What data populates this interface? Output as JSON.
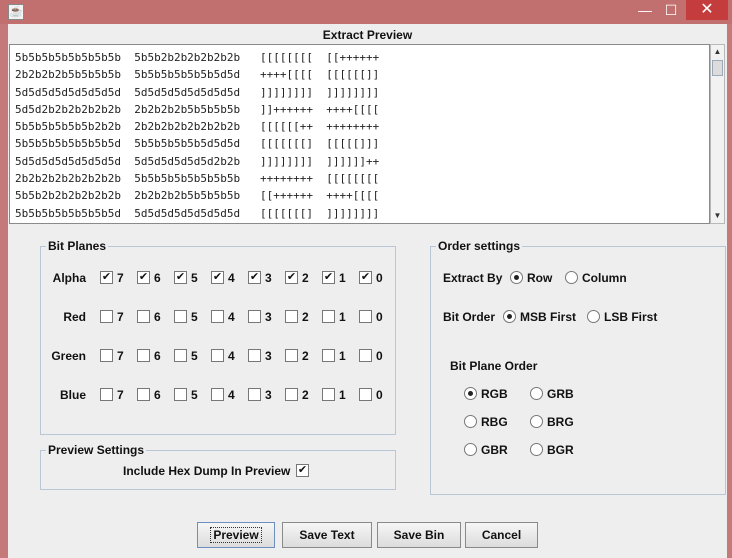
{
  "window": {
    "app_icon": "java-icon",
    "min_glyph": "—",
    "max_glyph": "☐",
    "close_glyph": "✕"
  },
  "preview": {
    "title": "Extract Preview",
    "lines": [
      "5b5b5b5b5b5b5b5b  5b5b2b2b2b2b2b2b   [[[[[[[[  [[++++++",
      "2b2b2b2b5b5b5b5b  5b5b5b5b5b5b5d5d   ++++[[[[  [[[[[[]]",
      "5d5d5d5d5d5d5d5d  5d5d5d5d5d5d5d5d   ]]]]]]]]  ]]]]]]]]",
      "5d5d2b2b2b2b2b2b  2b2b2b2b5b5b5b5b   ]]++++++  ++++[[[[",
      "5b5b5b5b5b5b2b2b  2b2b2b2b2b2b2b2b   [[[[[[++  ++++++++",
      "5b5b5b5b5b5b5b5d  5b5b5b5b5b5d5d5d   [[[[[[[]  [[[[[]]]",
      "5d5d5d5d5d5d5d5d  5d5d5d5d5d5d2b2b   ]]]]]]]]  ]]]]]]++",
      "2b2b2b2b2b2b2b2b  5b5b5b5b5b5b5b5b   ++++++++  [[[[[[[[",
      "5b5b2b2b2b2b2b2b  2b2b2b2b5b5b5b5b   [[++++++  ++++[[[[",
      "5b5b5b5b5b5b5b5d  5d5d5d5d5d5d5d5d   [[[[[[[]  ]]]]]]]]",
      "5d5d5d5d5d5d5d5d  5d5d5d2b2b2b2b2b   ]]]]]]]]  ]]]]]]]]"
    ]
  },
  "bit_planes": {
    "title": "Bit Planes",
    "bits": [
      "7",
      "6",
      "5",
      "4",
      "3",
      "2",
      "1",
      "0"
    ],
    "rows": [
      {
        "label": "Alpha",
        "checked": [
          true,
          true,
          true,
          true,
          true,
          true,
          true,
          true
        ]
      },
      {
        "label": "Red",
        "checked": [
          false,
          false,
          false,
          false,
          false,
          false,
          false,
          false
        ]
      },
      {
        "label": "Green",
        "checked": [
          false,
          false,
          false,
          false,
          false,
          false,
          false,
          false
        ]
      },
      {
        "label": "Blue",
        "checked": [
          false,
          false,
          false,
          false,
          false,
          false,
          false,
          false
        ]
      }
    ]
  },
  "preview_settings": {
    "title": "Preview Settings",
    "include_hex_label": "Include Hex Dump In Preview",
    "include_hex_checked": true
  },
  "order_settings": {
    "title": "Order settings",
    "extract_by_label": "Extract By",
    "extract_by_options": [
      "Row",
      "Column"
    ],
    "extract_by_selected": "Row",
    "bit_order_label": "Bit Order",
    "bit_order_options": [
      "MSB First",
      "LSB First"
    ],
    "bit_order_selected": "MSB First",
    "plane_order_title": "Bit Plane Order",
    "plane_order_options": [
      "RGB",
      "GRB",
      "RBG",
      "BRG",
      "GBR",
      "BGR"
    ],
    "plane_order_selected": "RGB"
  },
  "buttons": {
    "preview": "Preview",
    "save_text": "Save Text",
    "save_bin": "Save Bin",
    "cancel": "Cancel"
  },
  "check_glyph": "✔"
}
